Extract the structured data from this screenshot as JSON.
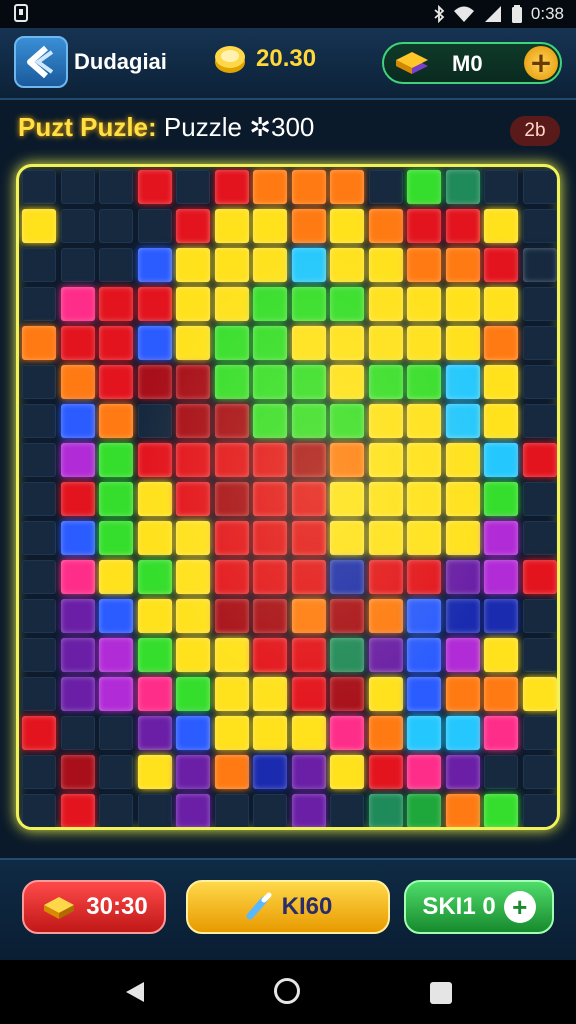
{
  "status_bar": {
    "time": "0:38",
    "icons": [
      "bluetooth-icon",
      "wifi-icon",
      "signal-icon",
      "battery-icon"
    ]
  },
  "header": {
    "user_name": "Dudagiai",
    "coins": "20.30",
    "gems": "M0",
    "icons": [
      "back-arrow-icon",
      "coin-icon",
      "gem-stack-icon",
      "plus-icon"
    ]
  },
  "title": {
    "part_a": "Puzt Puzle:",
    "part_b": "Puzzle",
    "score_symbol": "✲",
    "score": "300",
    "level_badge": "2b"
  },
  "board": {
    "cols": 14,
    "rows": 17,
    "color_key": {
      "r": "#e3141e",
      "R": "#a80f1a",
      "o": "#ff7a12",
      "y": "#ffe11c",
      "g": "#35de2c",
      "G": "#1ea83c",
      "b": "#2b5cff",
      "B": "#1a2bb0",
      "p": "#b12bd6",
      "P": "#6a1fa6",
      "m": "#ff2d8a",
      "c": "#24c8ff",
      "t": "#1f8a5a",
      "d": "#16293f"
    },
    "rows_data": [
      "dddrdrooodgtdd",
      "ydddryyoyorryd",
      "dddbyyycyyoorn",
      "dmrryygggyyyyd",
      "orrbyggyyyyyod",
      "dorRRgggyggcyd",
      "dbodRRgggyycyd",
      "dpgrrrrRoyyycr",
      "drgyrRrryyyygd",
      "dbgyyrrryyyypd",
      "dmygyrrrBrrPpr",
      "dPbyyRRoRobBBd",
      "dPpgyyrrtPbpyd",
      "dPpmgyyrRybooy",
      "rddPbyyymoccmd",
      "dRdyPoBPyrmPdd",
      "drddPddPdtGogd"
    ]
  },
  "actions": {
    "left_label": "30:30",
    "center_label": "KI60",
    "right_label": "SKI1 0"
  }
}
